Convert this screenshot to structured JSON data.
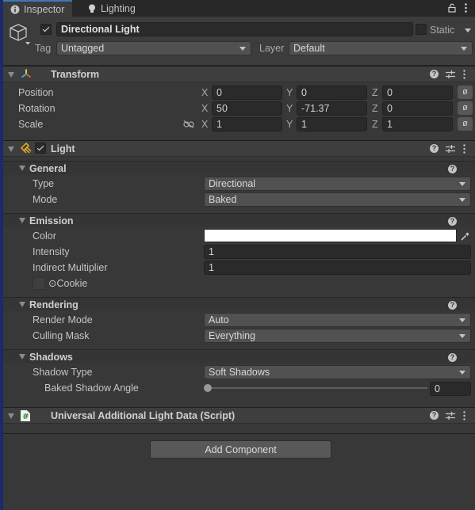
{
  "tabs": [
    {
      "label": "Inspector",
      "icon": "info-icon",
      "active": true
    },
    {
      "label": "Lighting",
      "icon": "lightbulb-icon",
      "active": false
    }
  ],
  "gameobject": {
    "active": true,
    "name": "Directional Light",
    "static_label": "Static",
    "static": false,
    "tag_label": "Tag",
    "tag": "Untagged",
    "layer_label": "Layer",
    "layer": "Default"
  },
  "transform": {
    "title": "Transform",
    "rows": [
      {
        "label": "Position",
        "x": "0",
        "y": "0",
        "z": "0"
      },
      {
        "label": "Rotation",
        "x": "50",
        "y": "-71.37",
        "z": "0"
      },
      {
        "label": "Scale",
        "x": "1",
        "y": "1",
        "z": "1"
      }
    ],
    "axis_labels": {
      "x": "X",
      "y": "Y",
      "z": "Z"
    },
    "reset_glyph": "ø"
  },
  "light": {
    "title": "Light",
    "enabled": true,
    "general": {
      "title": "General",
      "type_label": "Type",
      "type": "Directional",
      "mode_label": "Mode",
      "mode": "Baked"
    },
    "emission": {
      "title": "Emission",
      "color_label": "Color",
      "color": "#ffffff",
      "intensity_label": "Intensity",
      "intensity": "1",
      "indirect_label": "Indirect Multiplier",
      "indirect": "1",
      "cookie_label": "⊙Cookie"
    },
    "rendering": {
      "title": "Rendering",
      "render_mode_label": "Render Mode",
      "render_mode": "Auto",
      "culling_mask_label": "Culling Mask",
      "culling_mask": "Everything"
    },
    "shadows": {
      "title": "Shadows",
      "shadow_type_label": "Shadow Type",
      "shadow_type": "Soft Shadows",
      "baked_angle_label": "Baked Shadow Angle",
      "baked_angle": "0",
      "baked_angle_fraction": 0
    }
  },
  "script_component": {
    "title": "Universal Additional Light Data (Script)"
  },
  "add_component_label": "Add Component",
  "help_glyph": "?"
}
